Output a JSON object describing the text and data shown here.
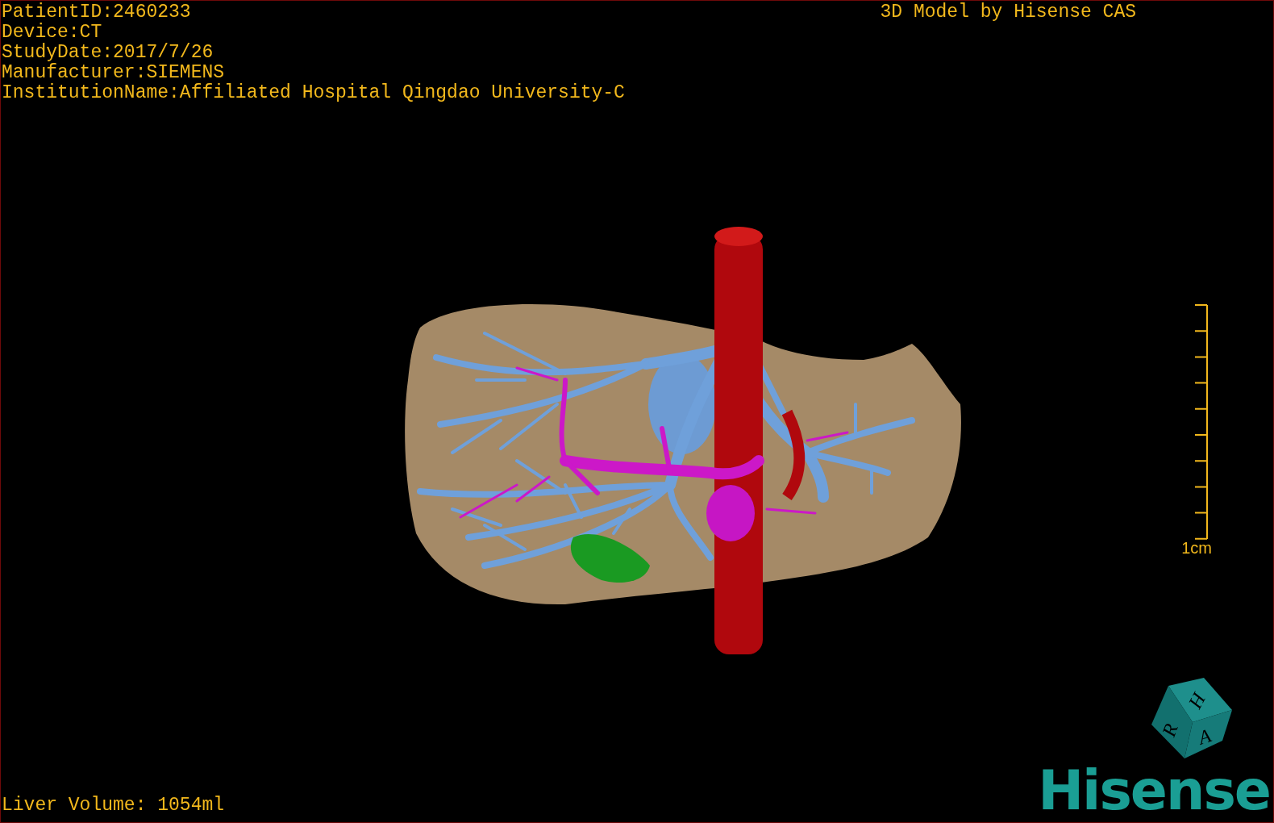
{
  "patient_info": [
    "PatientID:2460233",
    "Device:CT",
    "StudyDate:2017/7/26",
    "Manufacturer:SIEMENS",
    "InstitutionName:Affiliated Hospital Qingdao University-C"
  ],
  "title": "3D Model by Hisense CAS",
  "scale_bar": {
    "label": "1cm"
  },
  "orientation_cube": {
    "faces": [
      "H",
      "R",
      "A"
    ]
  },
  "liver_volume": "Liver Volume: 1054ml",
  "logo": "Hisense"
}
